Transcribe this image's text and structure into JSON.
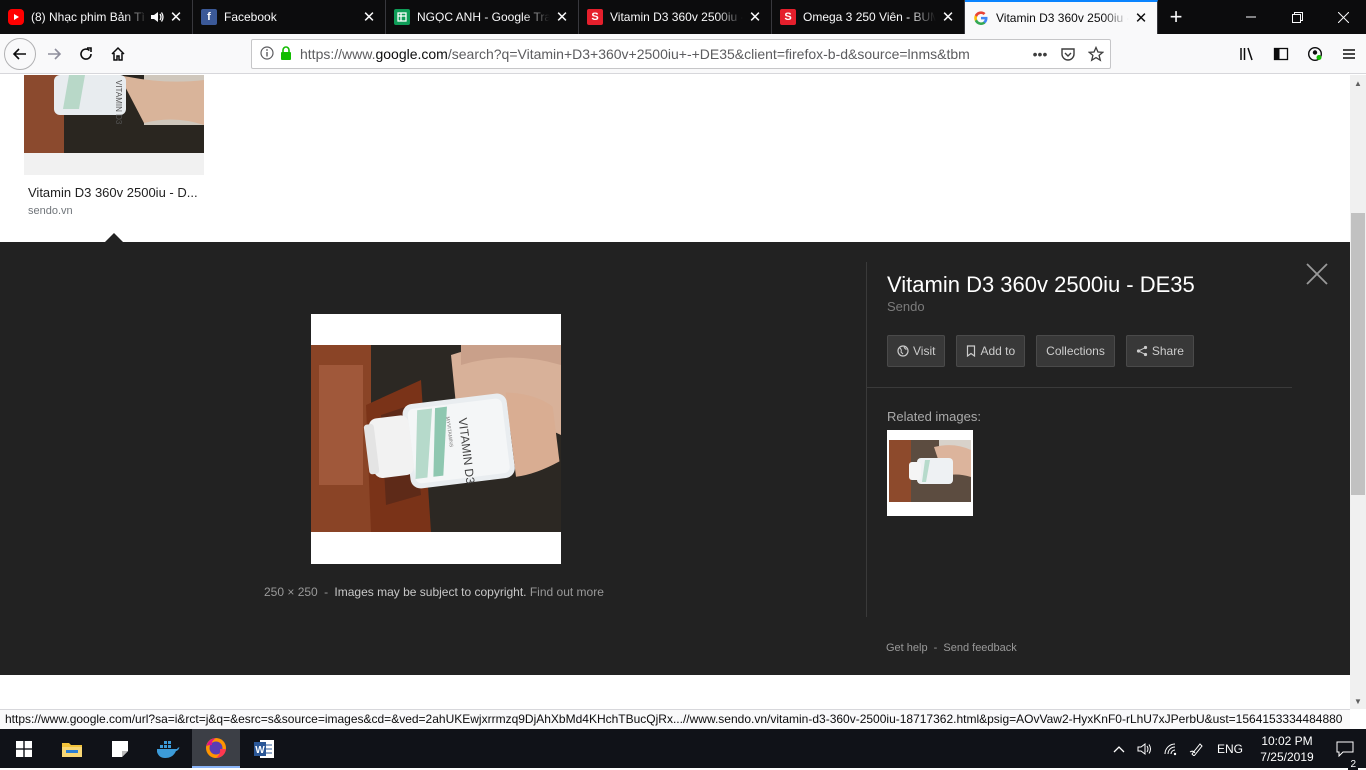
{
  "tabs": [
    {
      "title": "(8) Nhạc phim Bản Tì",
      "favicon": "youtube-icon",
      "color": "#ff0000",
      "sound": true
    },
    {
      "title": "Facebook",
      "favicon": "facebook-icon",
      "color": "#3b5998",
      "sound": false
    },
    {
      "title": "NGỌC ANH - Google Tra",
      "favicon": "google-sheets-icon",
      "color": "#0f9d58",
      "sound": false
    },
    {
      "title": "Vitamin D3 360v 2500iu -",
      "favicon": "sendo-icon",
      "color": "#e51f2c",
      "sound": false
    },
    {
      "title": "Omega 3 250 Viên - BUM",
      "favicon": "sendo-icon",
      "color": "#e51f2c",
      "sound": false
    },
    {
      "title": "Vitamin D3 360v 2500iu -",
      "favicon": "google-icon",
      "color": "#4285f4",
      "sound": false,
      "active": true
    }
  ],
  "nav": {
    "url_prefix": "https://www.",
    "url_host": "google.com",
    "url_rest": "/search?q=Vitamin+D3+360v+2500iu+-+DE35&client=firefox-b-d&source=lnms&tbm"
  },
  "thumbnail": {
    "caption": "Vitamin D3 360v 2500iu - D...",
    "source": "sendo.vn"
  },
  "panel": {
    "title": "Vitamin D3 360v 2500iu - DE35",
    "site": "Sendo",
    "buttons": {
      "visit": "Visit",
      "add_to": "Add to",
      "collections": "Collections",
      "share": "Share"
    },
    "image_size": "250 × 250",
    "separator": "-",
    "copyright": "Images may be subject to copyright.",
    "find_out_more": "Find out more",
    "related_title": "Related images:",
    "get_help": "Get help",
    "send_feedback": "Send feedback"
  },
  "status_url": "https://www.google.com/url?sa=i&rct=j&q=&esrc=s&source=images&cd=&ved=2ahUKEwjxrrmzq9DjAhXbMd4KHchTBucQjRx...//www.sendo.vn/vitamin-d3-360v-2500iu-18717362.html&psig=AOvVaw2-HyxKnF0-rLhU7xJPerbU&ust=1564153334484880",
  "taskbar": {
    "language": "ENG",
    "time": "10:02 PM",
    "date": "7/25/2019",
    "notification_count": "2"
  },
  "product_image": {
    "bottle_label": "VITAMIN D3",
    "brand": "MYVITAMINS"
  }
}
